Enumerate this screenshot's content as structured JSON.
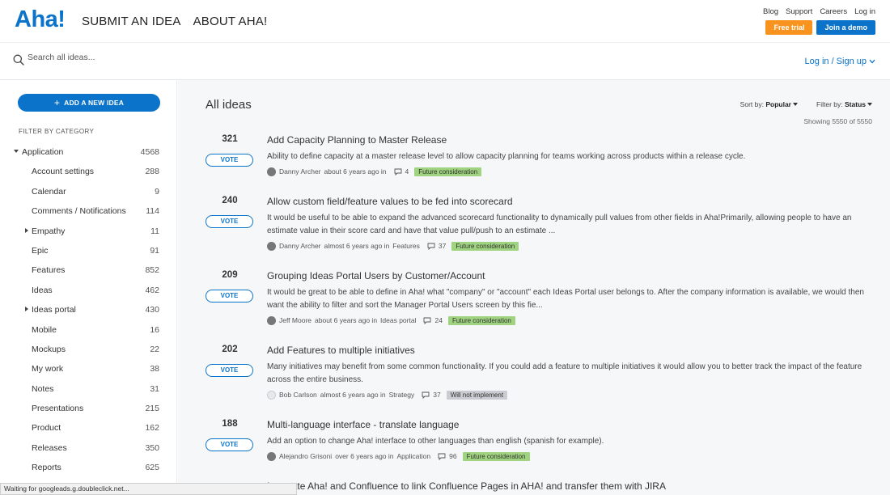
{
  "header": {
    "logo": "Aha!",
    "nav": [
      "SUBMIT AN IDEA",
      "ABOUT AHA!"
    ],
    "util_links": [
      "Blog",
      "Support",
      "Careers",
      "Log in"
    ],
    "free_trial": "Free trial",
    "join_demo": "Join a demo"
  },
  "search": {
    "placeholder": "Search all ideas...",
    "login": "Log in / Sign up"
  },
  "sidebar": {
    "add_label": "ADD A NEW IDEA",
    "filter_heading": "FILTER BY CATEGORY",
    "categories": [
      {
        "label": "Application",
        "count": "4568"
      },
      {
        "label": "Account settings",
        "count": "288"
      },
      {
        "label": "Calendar",
        "count": "9"
      },
      {
        "label": "Comments / Notifications",
        "count": "114"
      },
      {
        "label": "Empathy",
        "count": "11"
      },
      {
        "label": "Epic",
        "count": "91"
      },
      {
        "label": "Features",
        "count": "852"
      },
      {
        "label": "Ideas",
        "count": "462"
      },
      {
        "label": "Ideas portal",
        "count": "430"
      },
      {
        "label": "Mobile",
        "count": "16"
      },
      {
        "label": "Mockups",
        "count": "22"
      },
      {
        "label": "My work",
        "count": "38"
      },
      {
        "label": "Notes",
        "count": "31"
      },
      {
        "label": "Presentations",
        "count": "215"
      },
      {
        "label": "Product",
        "count": "162"
      },
      {
        "label": "Releases",
        "count": "350"
      },
      {
        "label": "Reports",
        "count": "625"
      }
    ]
  },
  "main": {
    "title": "All ideas",
    "sort_prefix": "Sort by:",
    "sort_value": "Popular",
    "filter_prefix": "Filter by:",
    "filter_value": "Status",
    "showing": "Showing 5550 of 5550",
    "vote_label": "VOTE",
    "ideas": [
      {
        "votes": "321",
        "title": "Add Capacity Planning to Master Release",
        "desc": "Ability to define capacity at a master release level to allow capacity planning for teams working across products within a release cycle.",
        "author": "Danny Archer",
        "meta": "about 6 years ago in",
        "category": "",
        "comments": "4",
        "status": "Future consideration"
      },
      {
        "votes": "240",
        "title": "Allow custom field/feature values to be fed into scorecard",
        "desc": "It would be useful to be able to expand the advanced scorecard functionality to dynamically pull values from other fields in Aha!Primarily, allowing people to have an estimate value in their score card and have that value pull/push to an estimate ...",
        "author": "Danny Archer",
        "meta": "almost 6 years ago in",
        "category": "Features",
        "comments": "37",
        "status": "Future consideration"
      },
      {
        "votes": "209",
        "title": "Grouping Ideas Portal Users by Customer/Account",
        "desc": "It would be great to be able to define in Aha! what \"company\" or \"account\" each Ideas Portal user belongs to. After the company information is available, we would then want the ability to filter and sort the Manager Portal Users screen by this fie...",
        "author": "Jeff Moore",
        "meta": "about 6 years ago in",
        "category": "Ideas portal",
        "comments": "24",
        "status": "Future consideration"
      },
      {
        "votes": "202",
        "title": "Add Features to multiple initiatives",
        "desc": "Many initiatives may benefit from some common functionality. If you could add a feature to multiple initiatives it would allow you to better track the impact of the feature across the entire business.",
        "author": "Bob Carlson",
        "meta": "almost 6 years ago in",
        "category": "Strategy",
        "comments": "37",
        "status": "Will not implement"
      },
      {
        "votes": "188",
        "title": "Multi-language interface - translate language",
        "desc": "Add an option to change Aha! interface to other languages than english (spanish for example).",
        "author": "Alejandro Grisoni",
        "meta": "over 6 years ago in",
        "category": "Application",
        "comments": "96",
        "status": "Future consideration"
      },
      {
        "votes": "",
        "title": "Integrate Aha! and Confluence to link Confluence Pages in AHA! and transfer them with JIRA",
        "desc": "",
        "author": "",
        "meta": "",
        "category": "",
        "comments": "",
        "status": ""
      }
    ]
  },
  "statusbar": "Waiting for googleads.g.doubleclick.net..."
}
